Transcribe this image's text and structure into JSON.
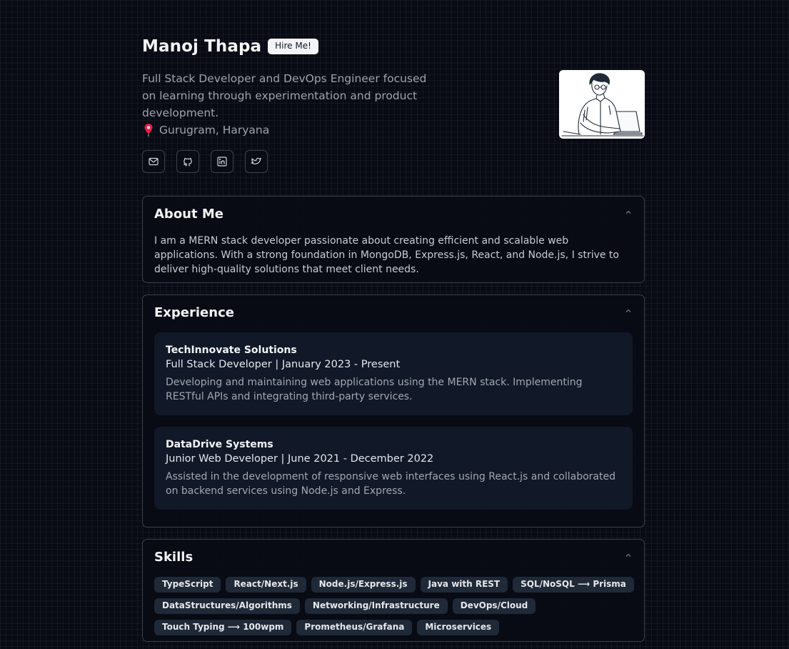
{
  "profile": {
    "name": "Manoj Thapa",
    "hire_label": "Hire Me!",
    "bio": "Full Stack Developer and DevOps Engineer focused on learning through experimentation and product development.",
    "location": "Gurugram, Haryana"
  },
  "socials": [
    {
      "icon": "mail-icon"
    },
    {
      "icon": "github-icon"
    },
    {
      "icon": "linkedin-icon"
    },
    {
      "icon": "twitter-icon"
    }
  ],
  "about": {
    "title": "About Me",
    "text": "I am a MERN stack developer passionate about creating efficient and scalable web applications. With a strong foundation in MongoDB, Express.js, React, and Node.js, I strive to deliver high-quality solutions that meet client needs."
  },
  "experience": {
    "title": "Experience",
    "items": [
      {
        "company": "TechInnovate Solutions",
        "role": "Full Stack Developer | January 2023 - Present",
        "description": "Developing and maintaining web applications using the MERN stack. Implementing RESTful APIs and integrating third-party services."
      },
      {
        "company": "DataDrive Systems",
        "role": "Junior Web Developer | June 2021 - December 2022",
        "description": "Assisted in the development of responsive web interfaces using React.js and collaborated on backend services using Node.js and Express."
      }
    ]
  },
  "skills": {
    "title": "Skills",
    "items": [
      "TypeScript",
      "React/Next.js",
      "Node.js/Express.js",
      "Java with REST",
      "SQL/NoSQL ⟶ Prisma",
      "DataStructures/Algorithms",
      "Networking/Infrastructure",
      "DevOps/Cloud",
      "Touch Typing ⟶ 100wpm",
      "Prometheus/Grafana",
      "Microservices"
    ]
  },
  "colors": {
    "background": "#080b14",
    "card_border": "#374151",
    "inner_card": "#111827",
    "chip": "#1f2937",
    "pin": "#e11d48"
  }
}
